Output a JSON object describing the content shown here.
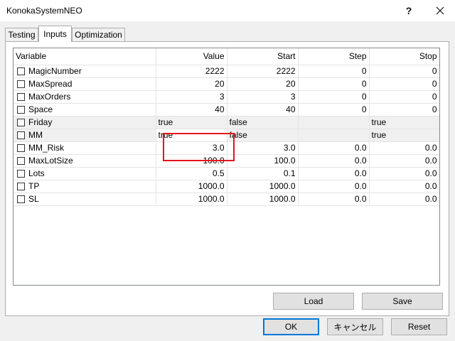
{
  "window": {
    "title": "KonokaSystemNEO"
  },
  "tabs": [
    {
      "label": "Testing",
      "active": false
    },
    {
      "label": "Inputs",
      "active": true
    },
    {
      "label": "Optimization",
      "active": false
    }
  ],
  "grid": {
    "columns": [
      "Variable",
      "Value",
      "Start",
      "Step",
      "Stop"
    ],
    "rows": [
      {
        "name": "MagicNumber",
        "value": "2222",
        "start": "2222",
        "step": "0",
        "stop": "0"
      },
      {
        "name": "MaxSpread",
        "value": "20",
        "start": "20",
        "step": "0",
        "stop": "0"
      },
      {
        "name": "MaxOrders",
        "value": "3",
        "start": "3",
        "step": "0",
        "stop": "0"
      },
      {
        "name": "Space",
        "value": "40",
        "start": "40",
        "step": "0",
        "stop": "0"
      },
      {
        "name": "Friday",
        "value": "true",
        "start": "false",
        "step": "",
        "stop": "true"
      },
      {
        "name": "MM",
        "value": "true",
        "start": "false",
        "step": "",
        "stop": "true"
      },
      {
        "name": "MM_Risk",
        "value": "3.0",
        "start": "3.0",
        "step": "0.0",
        "stop": "0.0"
      },
      {
        "name": "MaxLotSize",
        "value": "100.0",
        "start": "100.0",
        "step": "0.0",
        "stop": "0.0"
      },
      {
        "name": "Lots",
        "value": "0.5",
        "start": "0.1",
        "step": "0.0",
        "stop": "0.0"
      },
      {
        "name": "TP",
        "value": "1000.0",
        "start": "1000.0",
        "step": "0.0",
        "stop": "0.0"
      },
      {
        "name": "SL",
        "value": "1000.0",
        "start": "1000.0",
        "step": "0.0",
        "stop": "0.0"
      }
    ]
  },
  "buttons": {
    "load": "Load",
    "save": "Save",
    "ok": "OK",
    "cancel": "キャンセル",
    "reset": "Reset"
  },
  "colors": {
    "highlight": "#e8131b",
    "accent": "#0078d7"
  }
}
